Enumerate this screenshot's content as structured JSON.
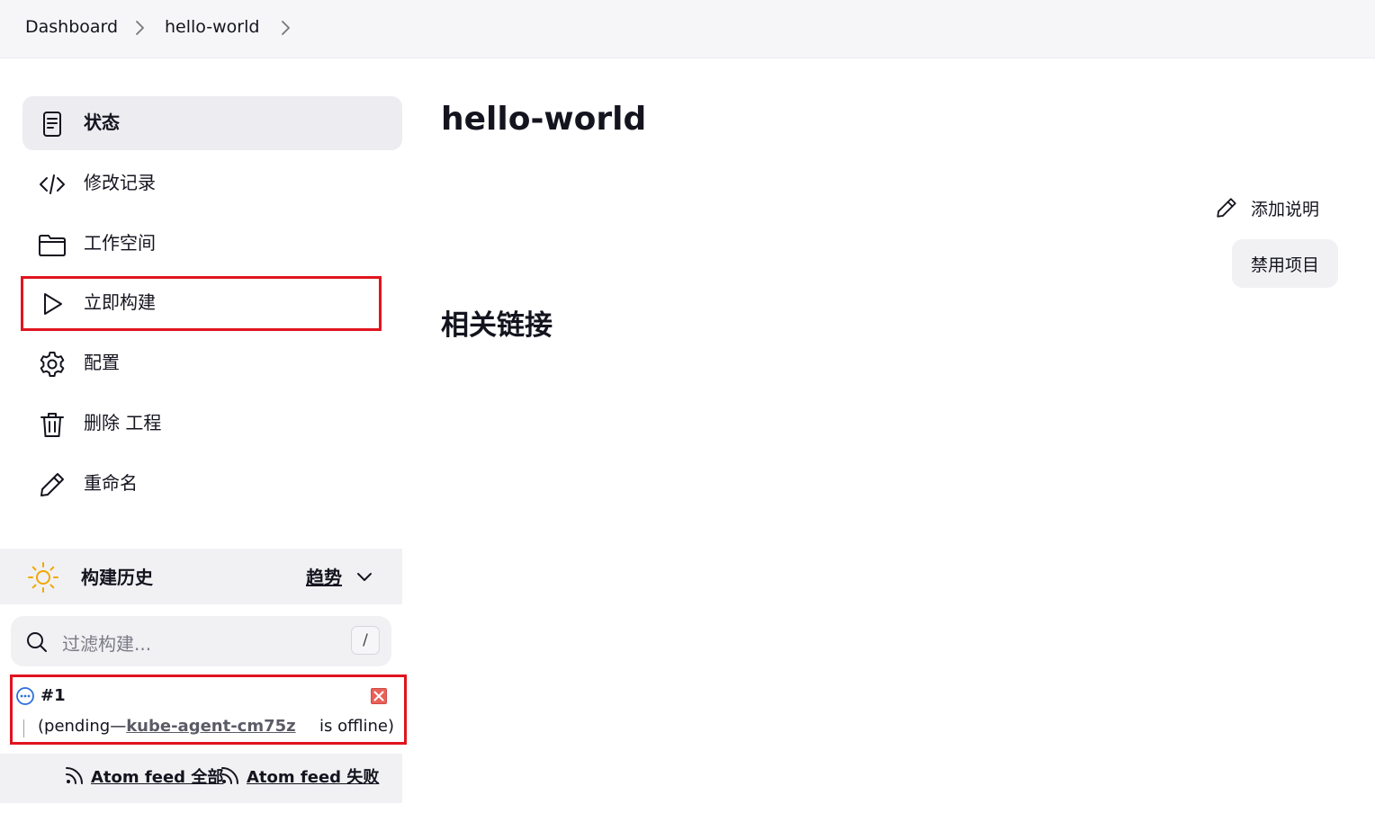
{
  "breadcrumb": {
    "items": [
      "Dashboard",
      "hello-world"
    ]
  },
  "sidebar": {
    "items": [
      {
        "label": "状态",
        "icon": "document-icon"
      },
      {
        "label": "修改记录",
        "icon": "code-icon"
      },
      {
        "label": "工作空间",
        "icon": "folder-icon"
      },
      {
        "label": "立即构建",
        "icon": "play-icon"
      },
      {
        "label": "配置",
        "icon": "gear-icon"
      },
      {
        "label": "删除 工程",
        "icon": "trash-icon"
      },
      {
        "label": "重命名",
        "icon": "pencil-icon"
      }
    ]
  },
  "main": {
    "title": "hello-world",
    "add_description": "添加说明",
    "disable_project": "禁用项目",
    "related_links": "相关链接"
  },
  "build_history": {
    "title": "构建历史",
    "trend_label": "趋势",
    "filter_placeholder": "过滤构建...",
    "shortcut": "/",
    "builds": [
      {
        "number": "#1",
        "pending_prefix": "(pending—",
        "agent": "kube-agent-cm75z",
        "offline_suffix": "is offline)"
      }
    ],
    "feeds": {
      "all": "Atom feed 全部",
      "failed": "Atom feed 失败"
    }
  },
  "colors": {
    "highlight": "#e0141f",
    "active_bg": "#ececf1",
    "sun": "#f0a800",
    "pending": "#2f6fde"
  }
}
